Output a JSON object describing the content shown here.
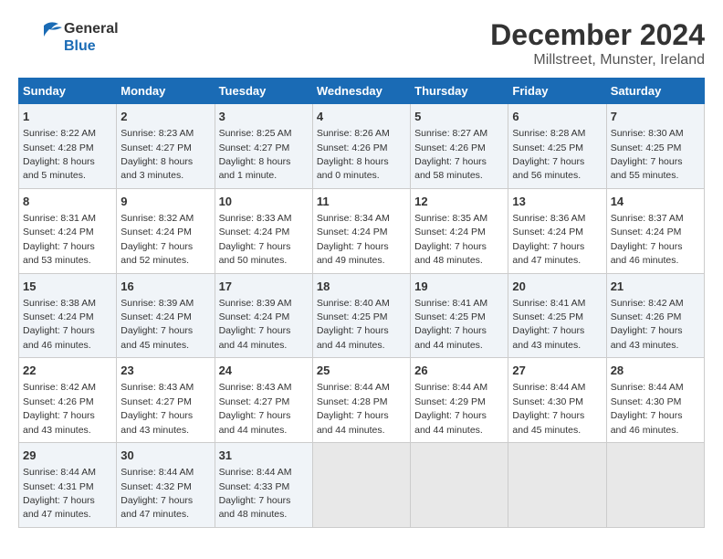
{
  "header": {
    "logo_line1": "General",
    "logo_line2": "Blue",
    "title": "December 2024",
    "subtitle": "Millstreet, Munster, Ireland"
  },
  "days_of_week": [
    "Sunday",
    "Monday",
    "Tuesday",
    "Wednesday",
    "Thursday",
    "Friday",
    "Saturday"
  ],
  "weeks": [
    [
      {
        "day": "1",
        "sunrise": "Sunrise: 8:22 AM",
        "sunset": "Sunset: 4:28 PM",
        "daylight": "Daylight: 8 hours and 5 minutes."
      },
      {
        "day": "2",
        "sunrise": "Sunrise: 8:23 AM",
        "sunset": "Sunset: 4:27 PM",
        "daylight": "Daylight: 8 hours and 3 minutes."
      },
      {
        "day": "3",
        "sunrise": "Sunrise: 8:25 AM",
        "sunset": "Sunset: 4:27 PM",
        "daylight": "Daylight: 8 hours and 1 minute."
      },
      {
        "day": "4",
        "sunrise": "Sunrise: 8:26 AM",
        "sunset": "Sunset: 4:26 PM",
        "daylight": "Daylight: 8 hours and 0 minutes."
      },
      {
        "day": "5",
        "sunrise": "Sunrise: 8:27 AM",
        "sunset": "Sunset: 4:26 PM",
        "daylight": "Daylight: 7 hours and 58 minutes."
      },
      {
        "day": "6",
        "sunrise": "Sunrise: 8:28 AM",
        "sunset": "Sunset: 4:25 PM",
        "daylight": "Daylight: 7 hours and 56 minutes."
      },
      {
        "day": "7",
        "sunrise": "Sunrise: 8:30 AM",
        "sunset": "Sunset: 4:25 PM",
        "daylight": "Daylight: 7 hours and 55 minutes."
      }
    ],
    [
      {
        "day": "8",
        "sunrise": "Sunrise: 8:31 AM",
        "sunset": "Sunset: 4:24 PM",
        "daylight": "Daylight: 7 hours and 53 minutes."
      },
      {
        "day": "9",
        "sunrise": "Sunrise: 8:32 AM",
        "sunset": "Sunset: 4:24 PM",
        "daylight": "Daylight: 7 hours and 52 minutes."
      },
      {
        "day": "10",
        "sunrise": "Sunrise: 8:33 AM",
        "sunset": "Sunset: 4:24 PM",
        "daylight": "Daylight: 7 hours and 50 minutes."
      },
      {
        "day": "11",
        "sunrise": "Sunrise: 8:34 AM",
        "sunset": "Sunset: 4:24 PM",
        "daylight": "Daylight: 7 hours and 49 minutes."
      },
      {
        "day": "12",
        "sunrise": "Sunrise: 8:35 AM",
        "sunset": "Sunset: 4:24 PM",
        "daylight": "Daylight: 7 hours and 48 minutes."
      },
      {
        "day": "13",
        "sunrise": "Sunrise: 8:36 AM",
        "sunset": "Sunset: 4:24 PM",
        "daylight": "Daylight: 7 hours and 47 minutes."
      },
      {
        "day": "14",
        "sunrise": "Sunrise: 8:37 AM",
        "sunset": "Sunset: 4:24 PM",
        "daylight": "Daylight: 7 hours and 46 minutes."
      }
    ],
    [
      {
        "day": "15",
        "sunrise": "Sunrise: 8:38 AM",
        "sunset": "Sunset: 4:24 PM",
        "daylight": "Daylight: 7 hours and 46 minutes."
      },
      {
        "day": "16",
        "sunrise": "Sunrise: 8:39 AM",
        "sunset": "Sunset: 4:24 PM",
        "daylight": "Daylight: 7 hours and 45 minutes."
      },
      {
        "day": "17",
        "sunrise": "Sunrise: 8:39 AM",
        "sunset": "Sunset: 4:24 PM",
        "daylight": "Daylight: 7 hours and 44 minutes."
      },
      {
        "day": "18",
        "sunrise": "Sunrise: 8:40 AM",
        "sunset": "Sunset: 4:25 PM",
        "daylight": "Daylight: 7 hours and 44 minutes."
      },
      {
        "day": "19",
        "sunrise": "Sunrise: 8:41 AM",
        "sunset": "Sunset: 4:25 PM",
        "daylight": "Daylight: 7 hours and 44 minutes."
      },
      {
        "day": "20",
        "sunrise": "Sunrise: 8:41 AM",
        "sunset": "Sunset: 4:25 PM",
        "daylight": "Daylight: 7 hours and 43 minutes."
      },
      {
        "day": "21",
        "sunrise": "Sunrise: 8:42 AM",
        "sunset": "Sunset: 4:26 PM",
        "daylight": "Daylight: 7 hours and 43 minutes."
      }
    ],
    [
      {
        "day": "22",
        "sunrise": "Sunrise: 8:42 AM",
        "sunset": "Sunset: 4:26 PM",
        "daylight": "Daylight: 7 hours and 43 minutes."
      },
      {
        "day": "23",
        "sunrise": "Sunrise: 8:43 AM",
        "sunset": "Sunset: 4:27 PM",
        "daylight": "Daylight: 7 hours and 43 minutes."
      },
      {
        "day": "24",
        "sunrise": "Sunrise: 8:43 AM",
        "sunset": "Sunset: 4:27 PM",
        "daylight": "Daylight: 7 hours and 44 minutes."
      },
      {
        "day": "25",
        "sunrise": "Sunrise: 8:44 AM",
        "sunset": "Sunset: 4:28 PM",
        "daylight": "Daylight: 7 hours and 44 minutes."
      },
      {
        "day": "26",
        "sunrise": "Sunrise: 8:44 AM",
        "sunset": "Sunset: 4:29 PM",
        "daylight": "Daylight: 7 hours and 44 minutes."
      },
      {
        "day": "27",
        "sunrise": "Sunrise: 8:44 AM",
        "sunset": "Sunset: 4:30 PM",
        "daylight": "Daylight: 7 hours and 45 minutes."
      },
      {
        "day": "28",
        "sunrise": "Sunrise: 8:44 AM",
        "sunset": "Sunset: 4:30 PM",
        "daylight": "Daylight: 7 hours and 46 minutes."
      }
    ],
    [
      {
        "day": "29",
        "sunrise": "Sunrise: 8:44 AM",
        "sunset": "Sunset: 4:31 PM",
        "daylight": "Daylight: 7 hours and 47 minutes."
      },
      {
        "day": "30",
        "sunrise": "Sunrise: 8:44 AM",
        "sunset": "Sunset: 4:32 PM",
        "daylight": "Daylight: 7 hours and 47 minutes."
      },
      {
        "day": "31",
        "sunrise": "Sunrise: 8:44 AM",
        "sunset": "Sunset: 4:33 PM",
        "daylight": "Daylight: 7 hours and 48 minutes."
      },
      null,
      null,
      null,
      null
    ]
  ]
}
